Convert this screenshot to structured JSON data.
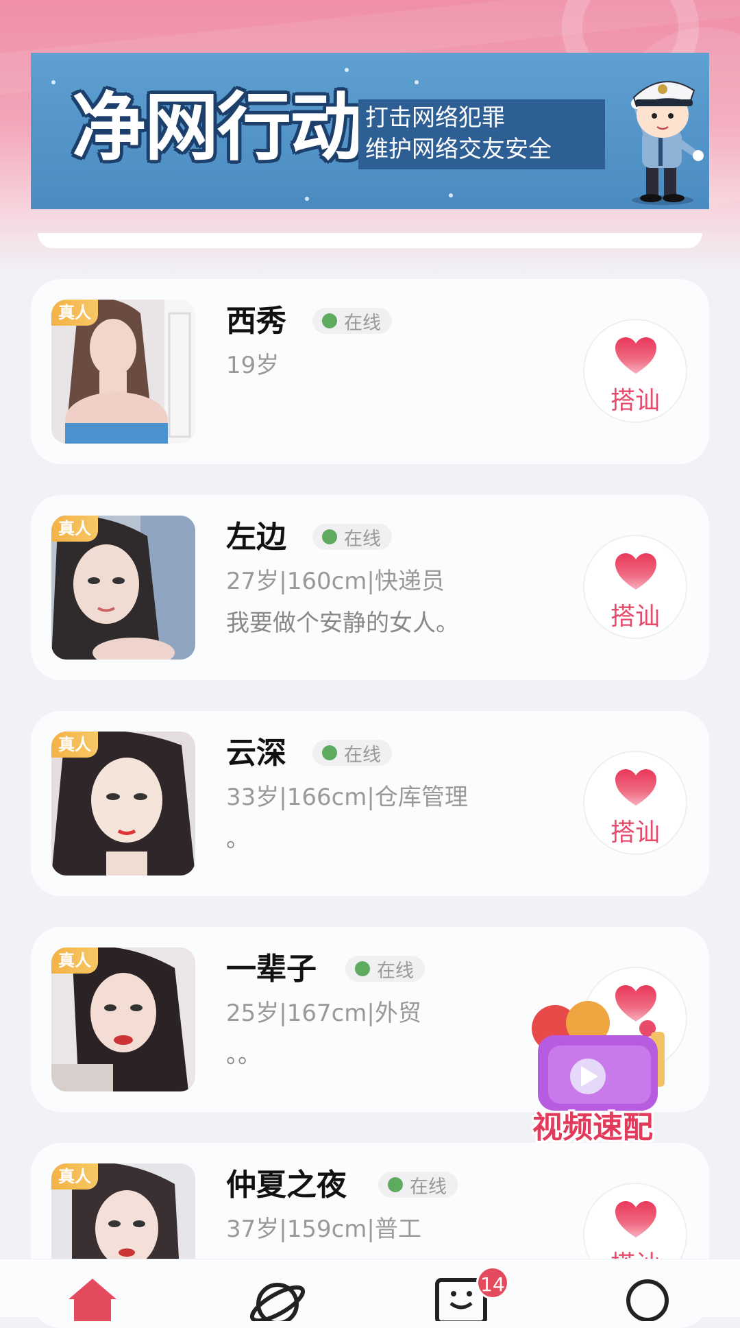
{
  "banner": {
    "title": "净网行动",
    "subtitle_line1": "打击网络犯罪",
    "subtitle_line2": "维护网络交友安全"
  },
  "list": {
    "verified_badge": "真人",
    "greet_label": "搭讪",
    "items": [
      {
        "name": "西秀",
        "status": "在线",
        "info": "19岁",
        "bio": ""
      },
      {
        "name": "左边",
        "status": "在线",
        "info": "27岁|160cm|快递员",
        "bio": "我要做个安静的女人。"
      },
      {
        "name": "云深",
        "status": "在线",
        "info": "33岁|166cm|仓库管理",
        "bio": "。"
      },
      {
        "name": "一辈子",
        "status": "在线",
        "info": "25岁|167cm|外贸",
        "bio": "。。"
      },
      {
        "name": "仲夏之夜",
        "status": "在线",
        "info": "37岁|159cm|普工",
        "bio": ""
      }
    ]
  },
  "floating": {
    "label": "视频速配"
  },
  "tabbar": {
    "tabs": [
      {
        "icon": "home-icon",
        "active": true
      },
      {
        "icon": "planet-icon",
        "active": false
      },
      {
        "icon": "message-icon",
        "active": false,
        "badge": "14"
      },
      {
        "icon": "profile-icon",
        "active": false
      }
    ]
  },
  "colors": {
    "accent": "#e44a6a",
    "online": "#5eaa5e",
    "badge": "#f3b246"
  }
}
